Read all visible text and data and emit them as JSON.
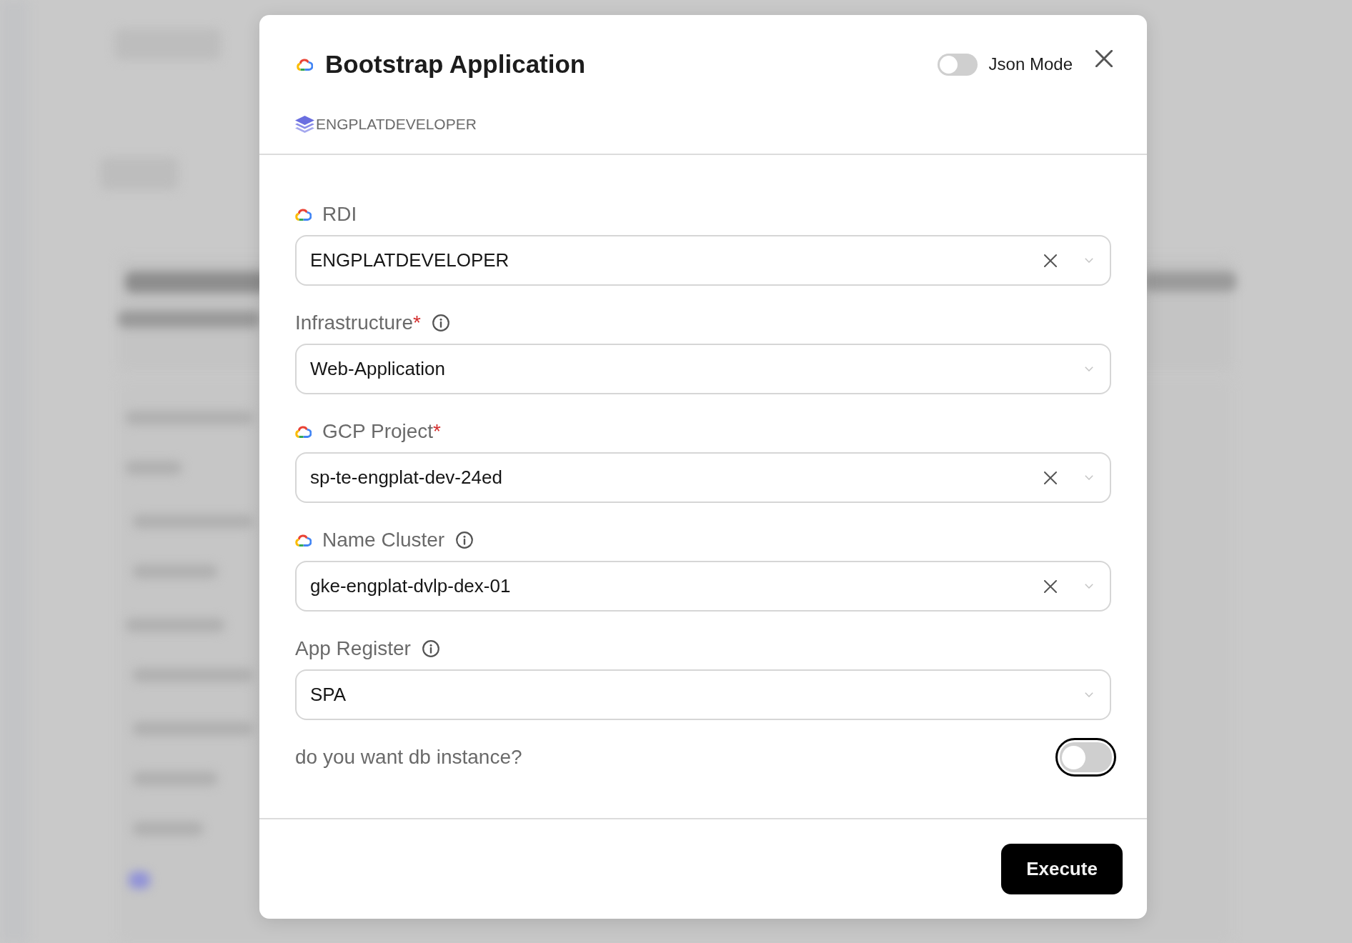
{
  "dialog": {
    "title": "Bootstrap Application",
    "json_mode": {
      "label": "Json Mode",
      "on": false
    },
    "subtitle": "ENGPLATDEVELOPER"
  },
  "fields": [
    {
      "kind": "select",
      "label": "RDI",
      "icon": true,
      "info_icon": false,
      "value": "ENGPLATDEVELOPER",
      "clearable": true
    },
    {
      "kind": "select",
      "label": "Infrastructure",
      "required_mark": "*",
      "icon": false,
      "info_icon": true,
      "value": "Web-Application",
      "clearable": false
    },
    {
      "kind": "select",
      "label": "GCP Project",
      "required_mark": "*",
      "icon": true,
      "info_icon": false,
      "value": "sp-te-engplat-dev-24ed",
      "clearable": true
    },
    {
      "kind": "select",
      "label": "Name Cluster",
      "icon": true,
      "info_icon": true,
      "value": "gke-engplat-dvlp-dex-01",
      "clearable": true
    },
    {
      "kind": "select",
      "label": "App Register",
      "icon": false,
      "info_icon": true,
      "value": "SPA",
      "clearable": false
    },
    {
      "kind": "toggle",
      "label": "do you want db instance?",
      "on": false,
      "focused": true
    }
  ],
  "actions": [
    {
      "label": "Execute"
    }
  ]
}
